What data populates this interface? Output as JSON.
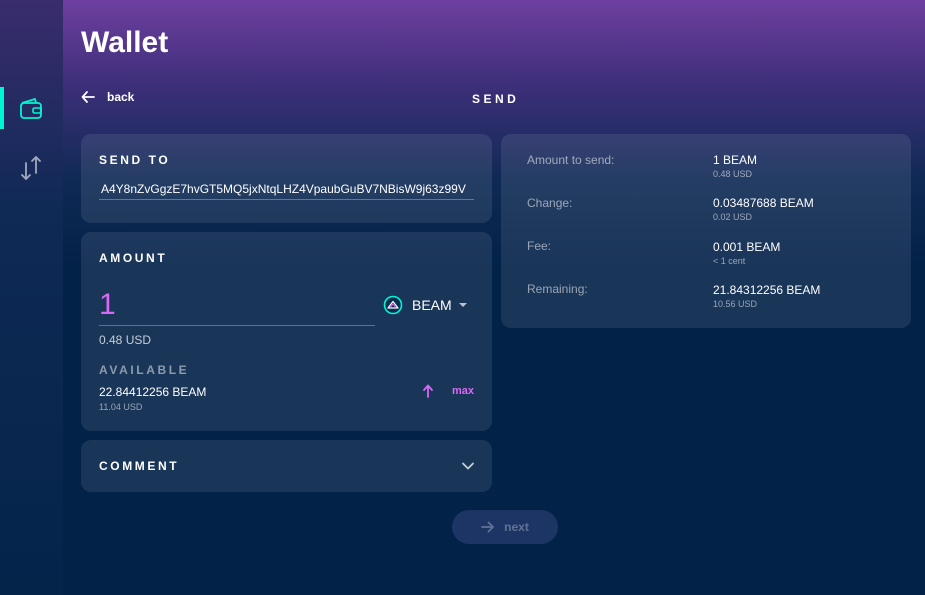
{
  "header": {
    "title": "Wallet"
  },
  "nav": {
    "back_label": "back",
    "section_title": "SEND",
    "sidebar_icons": [
      "wallet-icon",
      "transfer-icon"
    ],
    "accent_color": "#00f6d2"
  },
  "send_to": {
    "title": "SEND TO",
    "address": "A4Y8nZvGgzE7hvGT5MQ5jxNtqLHZ4VpaubGuBV7NBisW9j63z99V"
  },
  "amount": {
    "title": "AMOUNT",
    "value": "1",
    "currency": "BEAM",
    "usd": "0.48 USD",
    "available_label": "AVAILABLE",
    "available_value": "22.84412256 BEAM",
    "available_usd": "11.04 USD",
    "max_label": "max",
    "amount_color": "#da68f5"
  },
  "comment": {
    "title": "COMMENT"
  },
  "summary": {
    "rows": [
      {
        "label": "Amount to send:",
        "value": "1 BEAM",
        "sub": "0.48 USD"
      },
      {
        "label": "Change:",
        "value": "0.03487688 BEAM",
        "sub": "0.02 USD"
      },
      {
        "label": "Fee:",
        "value": "0.001 BEAM",
        "sub": "< 1 cent"
      },
      {
        "label": "Remaining:",
        "value": "21.84312256 BEAM",
        "sub": "10.56 USD"
      }
    ]
  },
  "actions": {
    "next_label": "next"
  }
}
